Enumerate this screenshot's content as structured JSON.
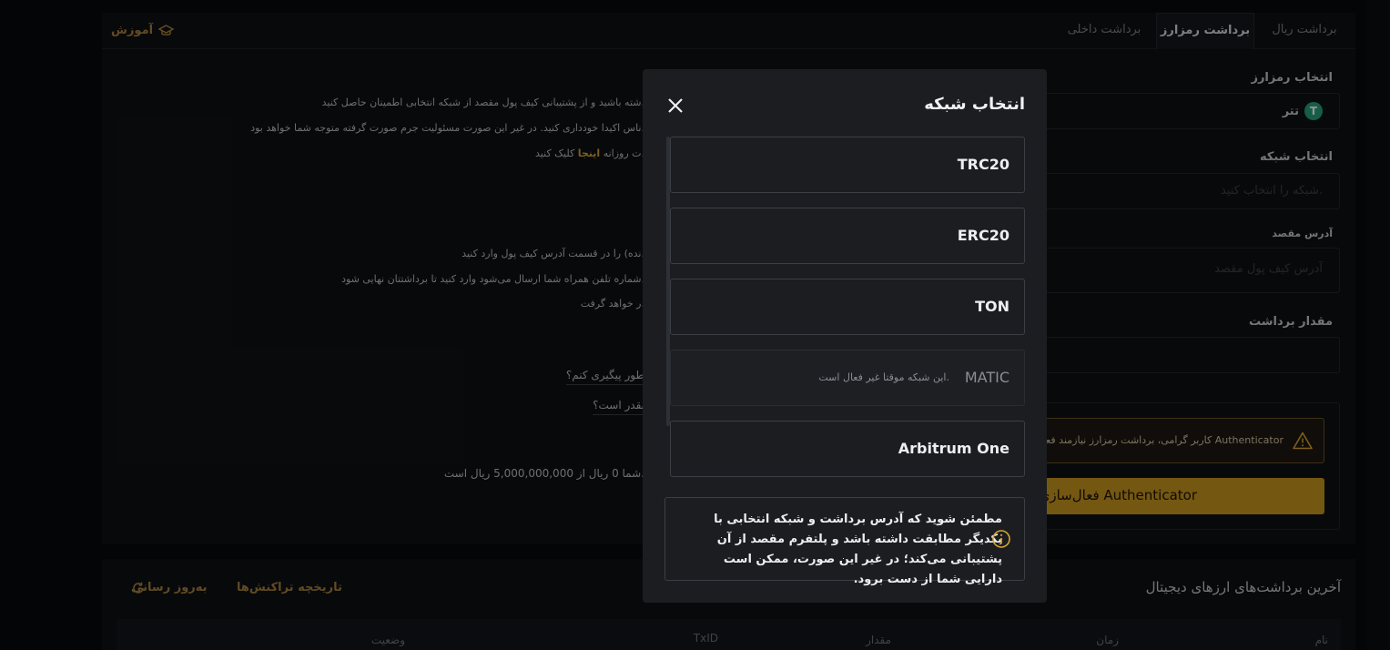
{
  "tabs": [
    {
      "label": "برداشت ریال"
    },
    {
      "label": "برداشت رمزارز"
    },
    {
      "label": "برداشت داخلی"
    }
  ],
  "learn_label": "آموزش",
  "form": {
    "currency_label": "انتخاب رمزارز",
    "currency_value": "تتر",
    "currency_icon": "T",
    "network_label": "انتخاب شبکه",
    "network_placeholder": "شبکه را انتخاب کنید.",
    "address_label": "آدرس مقصد",
    "address_placeholder": "آدرس کیف پول مقصد",
    "amount_label": "مقدار برداشت",
    "warning_text": "کاربر گرامی، برداشت رمزارز نیازمند فعال کردن Authenticator",
    "auth_button": "فعال‌سازی Authenticator"
  },
  "info": {
    "line1": "شته باشید و از پشتیبانی کیف پول مقصد از شبکه انتخابی اطمینان حاصل کنید.",
    "line2": "ناس اکیدا خودداری کنید. در غیر این صورت مسئولیت جرم صورت گرفته متوجه شما خواهد بود.",
    "line3_pre": "ت روزانه",
    "line3_link": "اینجا",
    "line3_post": "کلیک کنید.",
    "line4": "نده) را در قسمت آدرس کیف پول وارد کنید.",
    "line5": "شماره تلفن همراه شما ارسال می‌شود وارد کنید تا برداشتتان نهایی شود.",
    "line6": "ر خواهد گرفت.",
    "faq1": "طور پیگیری کنم؟",
    "faq2": "بقدر است؟",
    "limit": "شما 0 ریال از 5,000,000,000 ریال است."
  },
  "history": {
    "title": "آخرین برداشت‌های ارزهای دیجیتال",
    "tx_history": "تاریخچه تراکنش‌ها",
    "refresh": "به‌روز رسانی",
    "columns": [
      "نام",
      "زمان",
      "مقدار",
      "TxID",
      "وضعیت"
    ]
  },
  "modal": {
    "title": "انتخاب شبکه",
    "networks": [
      {
        "name": "TRC20",
        "note": ""
      },
      {
        "name": "ERC20",
        "note": ""
      },
      {
        "name": "TON",
        "note": ""
      },
      {
        "name": "MATIC",
        "note": "این شبکه موقتا غیر فعال است."
      },
      {
        "name": "Arbitrum One",
        "note": ""
      }
    ],
    "notice": "مطمئن شوید که آدرس برداشت و شبکه انتخابی با یکدیگر مطابقت داشته باشد و پلتفرم مقصد از آن پشتیبانی می‌کند؛ در غیر این صورت، ممکن است دارایی شما از دست برود."
  },
  "colors": {
    "accent": "#c9961e",
    "link": "#a6823d",
    "background": "#07090b",
    "modal": "#1b1d21"
  }
}
